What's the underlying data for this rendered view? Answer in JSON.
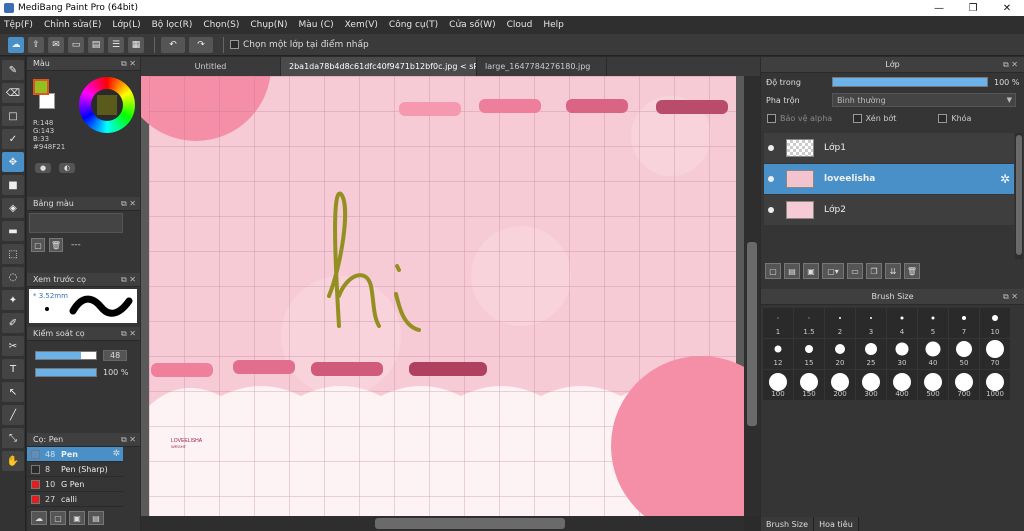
{
  "window": {
    "title": "MediBang Paint Pro (64bit)"
  },
  "menu": [
    "Tệp(F)",
    "Chỉnh sửa(E)",
    "Lớp(L)",
    "Bộ lọc(R)",
    "Chọn(S)",
    "Chụp(N)",
    "Màu (C)",
    "Xem(V)",
    "Công cụ(T)",
    "Cửa số(W)",
    "Cloud",
    "Help"
  ],
  "toolbar": {
    "select_layer_label": "Chọn một lớp tại điểm nhấp"
  },
  "color_panel": {
    "title": "Màu",
    "r": "R:148",
    "g": "G:143",
    "b": "B:33",
    "hex": "#948F21",
    "fg_color": "#94BF21"
  },
  "palette_panel": {
    "title": "Bảng màu",
    "dash": "---"
  },
  "preview_panel": {
    "title": "Xem trước cọ",
    "size": "* 3.52mm"
  },
  "brush_control": {
    "title": "Kiểm soát cọ",
    "size_value": "48",
    "opacity_value": "100 %",
    "size_fraction": 0.75,
    "opacity_fraction": 1.0
  },
  "brush_list": {
    "title": "Cọ: Pen",
    "items": [
      {
        "num": "48",
        "name": "Pen",
        "color": "#5a8fc0",
        "selected": true
      },
      {
        "num": "8",
        "name": "Pen (Sharp)",
        "color": "#2a2a2a",
        "selected": false
      },
      {
        "num": "10",
        "name": "G Pen",
        "color": "#e02020",
        "selected": false
      },
      {
        "num": "27",
        "name": "calli",
        "color": "#e02020",
        "selected": false
      }
    ]
  },
  "tabs": [
    {
      "label": "Untitled",
      "active": false
    },
    {
      "label": "2ba1da78b4d8c61dfc40f9471b12bf0c.jpg < sRGB >",
      "active": true
    },
    {
      "label": "large_1647784276180.jpg",
      "active": false
    }
  ],
  "canvas": {
    "drawn_text": "hi",
    "signature": "LOVEELISHA",
    "signature_sub": "WRGHT",
    "ink_color": "#948F21"
  },
  "layer_panel": {
    "title": "Lớp",
    "opacity_label": "Độ trong",
    "opacity_value": "100 %",
    "blend_label": "Pha trộn",
    "blend_value": "Bình thường",
    "alpha_protect": "Bảo vệ alpha",
    "clipping": "Xén bớt",
    "lock": "Khóa",
    "layers": [
      {
        "name": "Lớp1",
        "selected": false
      },
      {
        "name": "loveelisha",
        "selected": true
      },
      {
        "name": "Lớp2",
        "selected": false
      }
    ]
  },
  "brush_size_panel": {
    "title": "Brush Size",
    "sizes": [
      "1",
      "1.5",
      "2",
      "3",
      "4",
      "5",
      "7",
      "10",
      "12",
      "15",
      "20",
      "25",
      "30",
      "40",
      "50",
      "70",
      "100",
      "150",
      "200",
      "300",
      "400",
      "500",
      "700",
      "1000"
    ]
  },
  "bottom_tabs": [
    "Brush Size",
    "Hoa tiêu"
  ]
}
